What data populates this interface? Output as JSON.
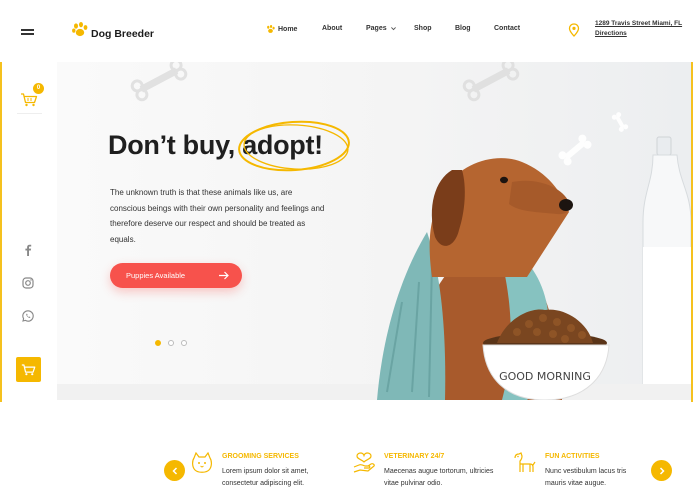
{
  "brand": {
    "name": "Dog Breeder"
  },
  "nav": {
    "items": [
      {
        "label": "Home"
      },
      {
        "label": "About"
      },
      {
        "label": "Pages"
      },
      {
        "label": "Shop"
      },
      {
        "label": "Blog"
      },
      {
        "label": "Contact"
      }
    ],
    "address": "1289 Travis Street Miami, FL Directions"
  },
  "cart": {
    "count": "0"
  },
  "social": [
    "facebook-icon",
    "instagram-icon",
    "whatsapp-icon"
  ],
  "hero": {
    "title_prefix": "Don’t buy, ",
    "title_highlight": "adopt!",
    "description": "The unknown truth is that these animals like us, are conscious beings with their own personality and feelings and therefore deserve our respect and should be treated as equals.",
    "button_label": "Puppies Available",
    "bowl_text": "GOOD MORNING",
    "slides": 3,
    "active_slide": 1
  },
  "features": [
    {
      "title": "GROOMING SERVICES",
      "text": "Lorem ipsum dolor sit amet, consectetur adipiscing elit.",
      "icon": "cat-icon"
    },
    {
      "title": "VETERINARY 24/7",
      "text": "Maecenas augue tortorum, ultricies vitae pulvinar odio.",
      "icon": "hand-heart-icon"
    },
    {
      "title": "FUN ACTIVITIES",
      "text": "Nunc vestibulum lacus tris mauris vitae augue.",
      "icon": "dog-icon"
    }
  ],
  "colors": {
    "accent": "#f5b800",
    "button": "#f7524c",
    "text": "#1f1f1f"
  }
}
